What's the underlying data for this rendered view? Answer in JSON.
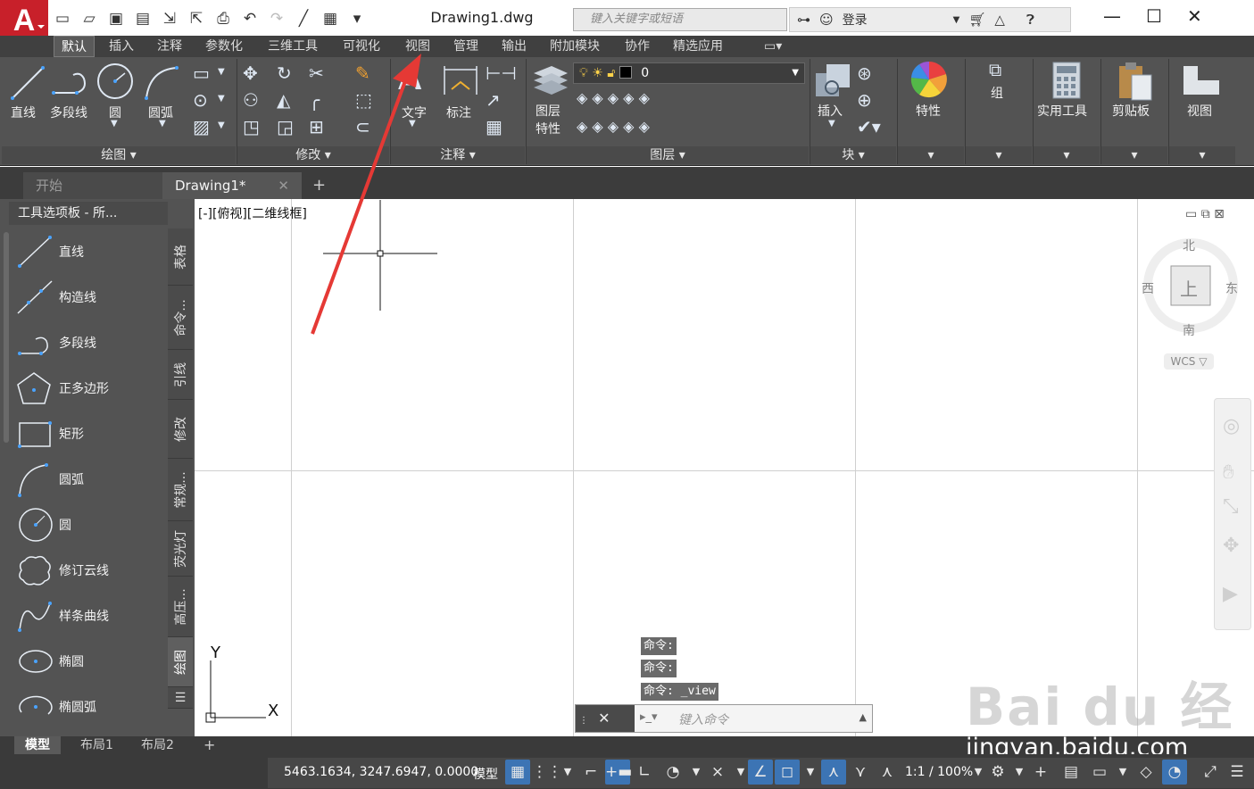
{
  "window": {
    "title": "Drawing1.dwg",
    "search_placeholder": "键入关键字或短语",
    "login_label": "登录"
  },
  "ribbon_tabs": [
    {
      "label": "默认",
      "active": true
    },
    {
      "label": "插入"
    },
    {
      "label": "注释"
    },
    {
      "label": "参数化"
    },
    {
      "label": "三维工具"
    },
    {
      "label": "可视化"
    },
    {
      "label": "视图"
    },
    {
      "label": "管理"
    },
    {
      "label": "输出"
    },
    {
      "label": "附加模块"
    },
    {
      "label": "协作"
    },
    {
      "label": "精选应用"
    }
  ],
  "ribbon": {
    "draw": {
      "line": "直线",
      "polyline": "多段线",
      "circle": "圆",
      "arc": "圆弧",
      "title": "绘图"
    },
    "modify": {
      "title": "修改"
    },
    "annotation": {
      "text": "文字",
      "dimension": "标注",
      "title": "注释"
    },
    "layers": {
      "layer_props_1": "图层",
      "layer_props_2": "特性",
      "current_layer": "0",
      "title": "图层"
    },
    "block": {
      "insert": "插入",
      "title": "块"
    },
    "properties": {
      "label": "特性"
    },
    "groups": {
      "label": "组"
    },
    "utilities": {
      "label": "实用工具"
    },
    "clipboard": {
      "label": "剪贴板"
    },
    "view": {
      "label": "视图"
    }
  },
  "file_tabs": [
    {
      "label": "开始"
    },
    {
      "label": "Drawing1*",
      "active": true
    }
  ],
  "palette": {
    "title": "工具选项板 - 所...",
    "items": [
      "直线",
      "构造线",
      "多段线",
      "正多边形",
      "矩形",
      "圆弧",
      "圆",
      "修订云线",
      "样条曲线",
      "椭圆",
      "椭圆弧"
    ],
    "side_tabs": [
      "表格",
      "命令...",
      "引线",
      "修改",
      "常规...",
      "荧光灯",
      "高压...",
      "绘图"
    ]
  },
  "canvas": {
    "viewport_label": "[-][俯视][二维线框]",
    "viewcube": {
      "north": "北",
      "south": "南",
      "east": "东",
      "west": "西",
      "face": "上",
      "wcs": "WCS"
    },
    "ucs": {
      "x": "X",
      "y": "Y"
    }
  },
  "command": {
    "history": [
      "命令:",
      "命令:",
      "命令: _view"
    ],
    "placeholder": "键入命令"
  },
  "layout_tabs": [
    {
      "label": "模型",
      "active": true
    },
    {
      "label": "布局1"
    },
    {
      "label": "布局2"
    }
  ],
  "status": {
    "coordinates": "5463.1634, 3247.6947, 0.0000",
    "model_label": "模型",
    "scale": "1:1 / 100%"
  },
  "watermark": {
    "logo": "Bai du 经验",
    "url": "jingyan.baidu.com"
  },
  "colors": {
    "accent": "#3c74b4",
    "logo_red": "#c8202a",
    "arrow_red": "#e53935"
  }
}
